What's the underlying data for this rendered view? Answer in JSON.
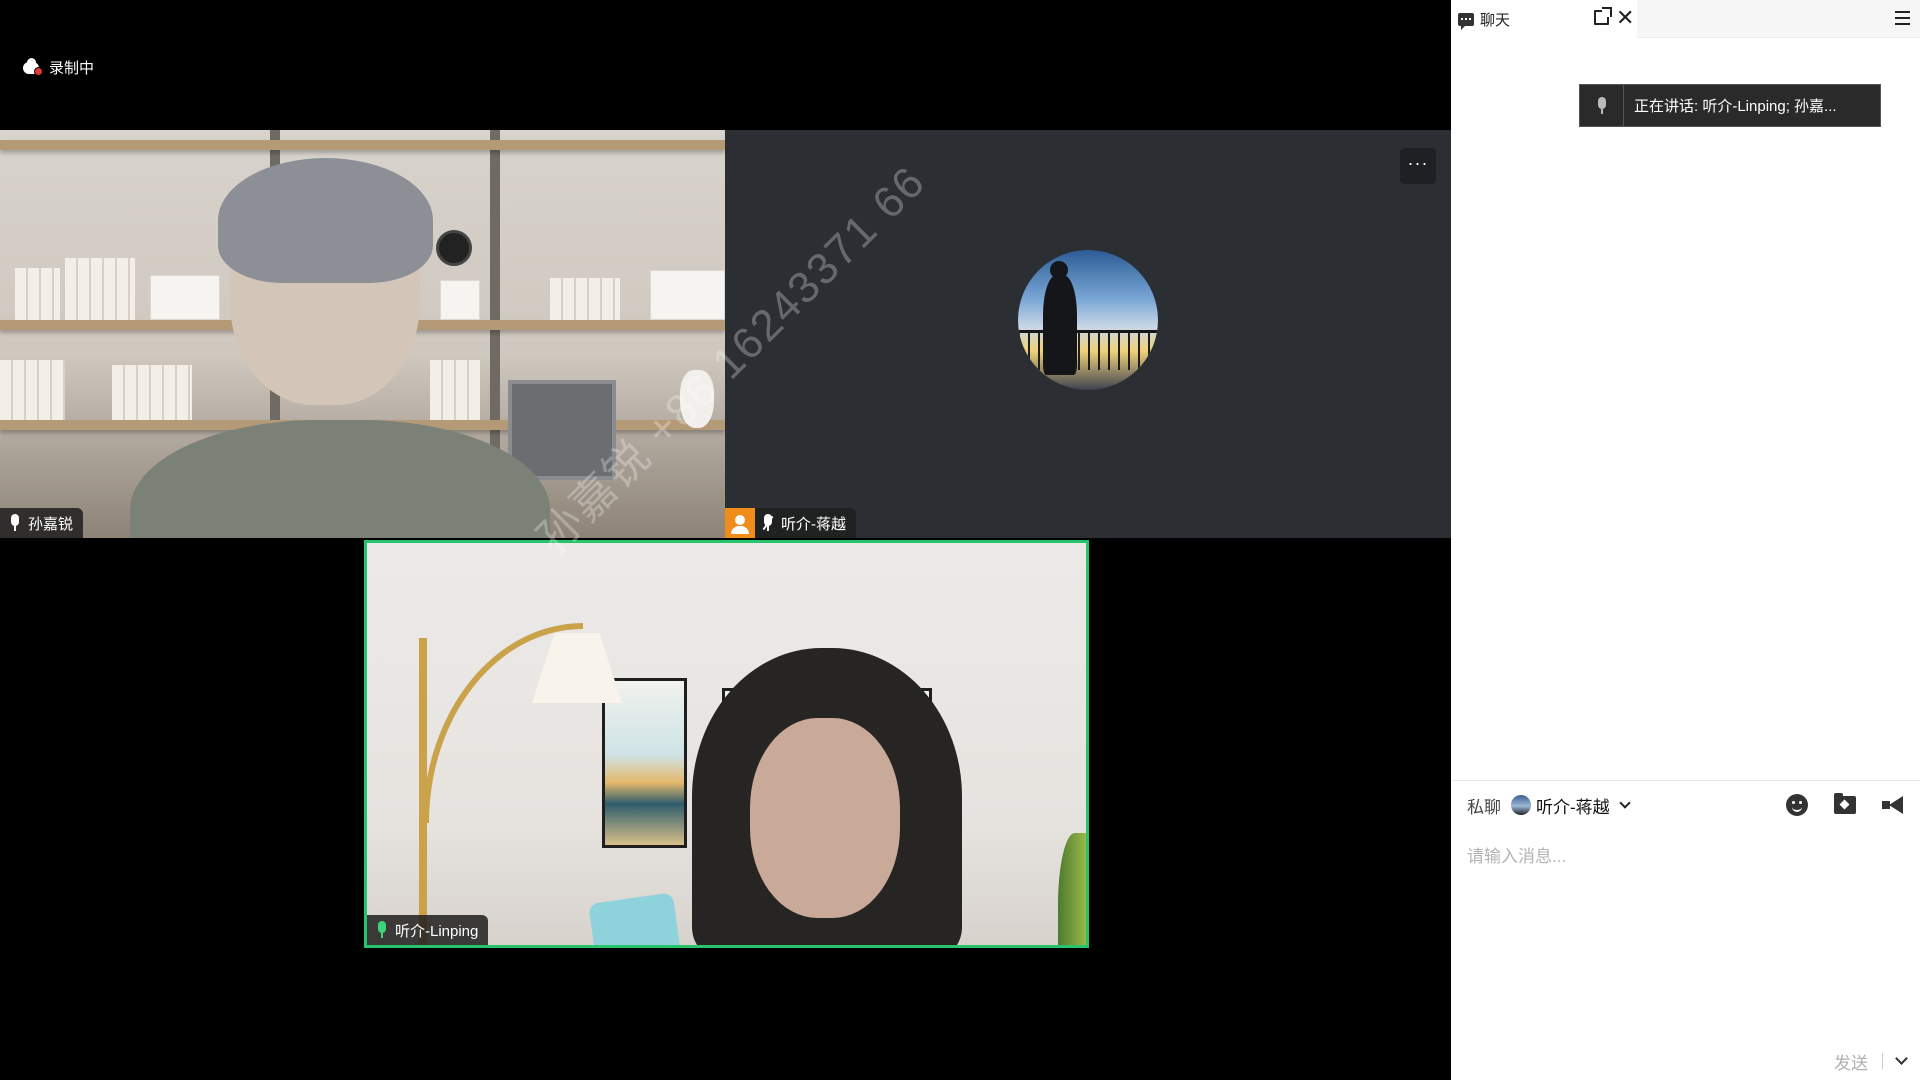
{
  "recording": {
    "label": "录制中",
    "icon": "cloud-record-icon"
  },
  "participants": [
    {
      "name": "孙嘉锐",
      "mic": "on",
      "video": "camera"
    },
    {
      "name": "听介-蒋越",
      "mic": "muted",
      "video": "avatar"
    },
    {
      "name": "听介-Linping",
      "mic": "speaking",
      "video": "camera",
      "active_speaker": true
    }
  ],
  "tile_menu": {
    "label": "···"
  },
  "watermark": "孙嘉锐 +86 16243371 66",
  "chat": {
    "tab_label": "聊天",
    "speaking_indicator": "正在讲话:  听介-Linping; 孙嘉...",
    "private_label": "私聊",
    "recipient": "听介-蒋越",
    "input_placeholder": "请输入消息...",
    "send_label": "发送"
  },
  "colors": {
    "active_speaker_border": "#27c46b",
    "user_chip": "#f08c1a",
    "tile_background": "#2b2f33"
  }
}
